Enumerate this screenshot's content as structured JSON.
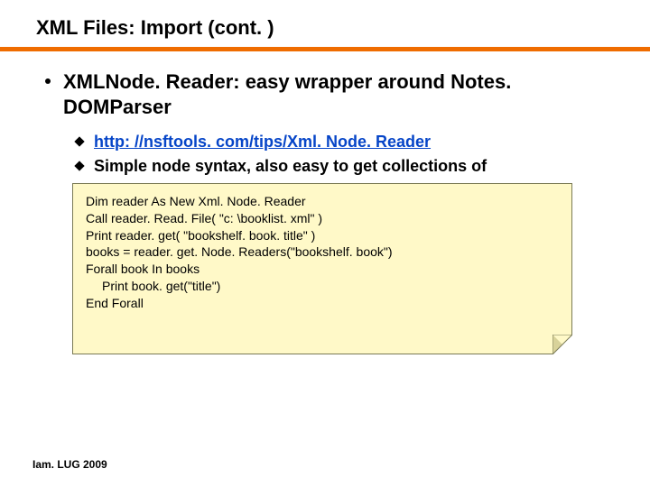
{
  "title": "XML Files: Import (cont. )",
  "heading": "XMLNode. Reader: easy wrapper around Notes. DOMParser",
  "bullets": {
    "link": "http: //nsftools. com/tips/Xml. Node. Reader",
    "second": "Simple node syntax, also easy to get collections of"
  },
  "code": {
    "l1": "Dim reader As New Xml. Node. Reader",
    "l2": "Call reader. Read. File( \"c: \\booklist. xml\" )",
    "l3": "Print reader. get( \"bookshelf. book. title\" )",
    "l4": "books = reader. get. Node. Readers(\"bookshelf. book\")",
    "l5": "Forall book In books",
    "l6": "Print book. get(\"title\")",
    "l7": "End Forall"
  },
  "footer": "Iam. LUG 2009"
}
